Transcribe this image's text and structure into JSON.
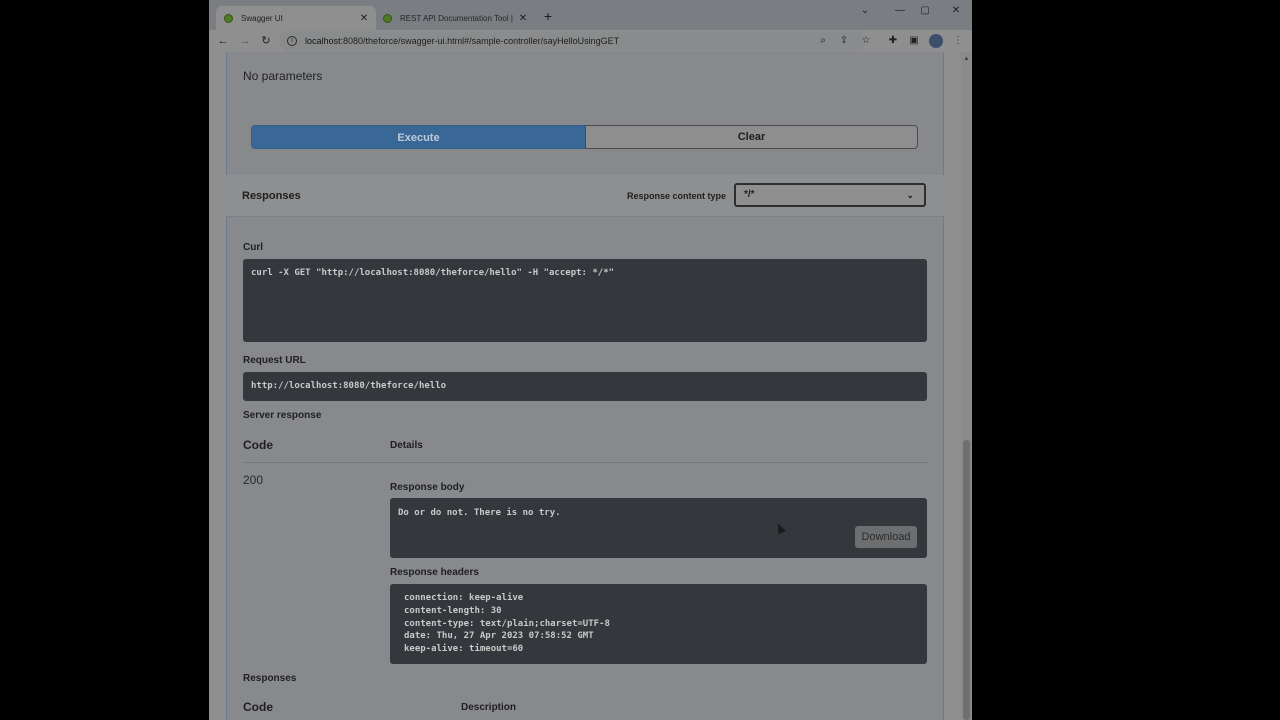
{
  "browser": {
    "tabs": [
      {
        "title": "Swagger UI",
        "active": true
      },
      {
        "title": "REST API Documentation Tool | S",
        "active": false
      }
    ],
    "new_tab_icon": "+",
    "window_controls": {
      "minimize": "⌄",
      "restore": "—",
      "maximize": "▢",
      "close": "✕"
    },
    "address": {
      "host": "localhost",
      "rest": ":8080/theforce/swagger-ui.html#/sample-controller/sayHelloUsingGET"
    }
  },
  "operation": {
    "parameters_text": "No parameters",
    "execute_label": "Execute",
    "clear_label": "Clear",
    "responses_title": "Responses",
    "response_content_type_label": "Response content type",
    "response_content_type_value": "*/*",
    "curl_label": "Curl",
    "curl_command": "curl -X GET \"http://localhost:8080/theforce/hello\" -H \"accept: */*\"",
    "request_url_label": "Request URL",
    "request_url": "http://localhost:8080/theforce/hello",
    "server_response_label": "Server response",
    "code_header": "Code",
    "details_header": "Details",
    "status_code": "200",
    "response_body_label": "Response body",
    "response_body": "Do or do not. There is no try.",
    "download_label": "Download",
    "response_headers_label": "Response headers",
    "response_headers": "connection: keep-alive\ncontent-length: 30\ncontent-type: text/plain;charset=UTF-8\ndate: Thu, 27 Apr 2023 07:58:52 GMT\nkeep-alive: timeout=60",
    "responses_section_label": "Responses",
    "code_header_2": "Code",
    "description_header": "Description"
  },
  "colors": {
    "execute": "#3a6896",
    "code_bg": "#34373c"
  }
}
